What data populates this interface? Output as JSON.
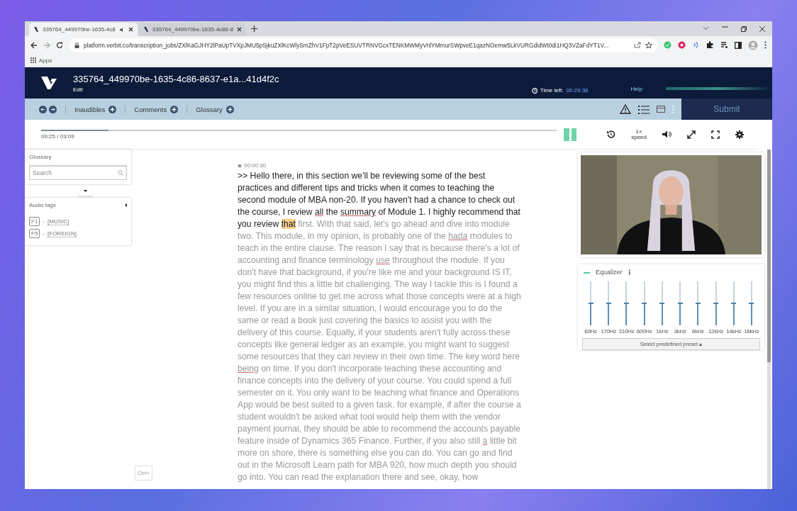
{
  "browser": {
    "tabs": [
      {
        "title": "335764_449970be-1635-4c8",
        "selected": true,
        "audio": true
      },
      {
        "title": "335764_449970be-1635-4c86-8",
        "selected": false,
        "audio": false
      }
    ],
    "url": "platform.verbit.co/transcription_jobs/ZXlKaGJHY2lPaUpTVXpJMU5pSjkuZXlKcWlySmZhV1FpT2pVeESUVTRNVGcxTENKMWMyVnlYMmurSWpveE1qazNOemw5LkVURGdidWt0di1HQ3VZaFdYT1V...",
    "bookmarks": [
      "Apps"
    ]
  },
  "app": {
    "job_title": "335764_449970be-1635-4c86-8637-e1a...41d4f2c",
    "subtitle": "Edit",
    "time_left_label": "Time left:",
    "time_left": "00:29:38",
    "help": "Help"
  },
  "toolbar": {
    "items": [
      {
        "label": "Inaudibles"
      },
      {
        "label": "Comments"
      },
      {
        "label": "Glossary"
      }
    ],
    "submit": "Submit"
  },
  "player": {
    "level": 0.13,
    "time": "00:25 / 03:09",
    "playing": true,
    "speed": "1×",
    "speed_label": "speed"
  },
  "glossary": {
    "title": "Glossary",
    "search": {
      "placeholder": "Search"
    },
    "expanded": true
  },
  "audio_tags": {
    "title": "Audio tags",
    "items": [
      {
        "key": "F1",
        "separator": "-",
        "tag": "[MUSIC]"
      },
      {
        "key": "F5",
        "separator": "-",
        "tag": "[FOREIGN]"
      }
    ]
  },
  "shortcut_button": "Ctrl+",
  "transcript": {
    "timestamp": "00:00:30",
    "played": [
      {
        "text": ">> Hello there, in this section we'll be reviewing some of the best practices and different tips and tricks when it comes to teaching the second module of MBA non-20. If you haven't had a chance to check out the course, I review ",
        "kind": "plain"
      },
      {
        "text": "all",
        "kind": "flagged"
      },
      {
        "text": " the ",
        "kind": "plain"
      },
      {
        "text": "summary",
        "kind": "flagged"
      },
      {
        "text": " of Module 1. I highly recommend that you review ",
        "kind": "plain"
      },
      {
        "text": "that",
        "kind": "current"
      }
    ],
    "upcoming": [
      {
        "text": " first. With that said, let's go ahead and dive into module two. This module, in my opinion, is probably one of the ",
        "kind": "plain"
      },
      {
        "text": "hada",
        "kind": "flagged"
      },
      {
        "text": " modules to teach in the entire clause. The reason I say that is because there's a lot of accounting and finance terminology ",
        "kind": "plain"
      },
      {
        "text": "use",
        "kind": "flagged"
      },
      {
        "text": " throughout the module. If you don't have that background, if you're like me and your background IS IT, you might find this a little bit challenging. The way I tackle this is I found a few resources online to get me across what those concepts were at a high level. If you are in a similar situation, I would encourage you to do the same or read a book just covering the basics to assist you with the delivery of this course. Equally, if your students aren't fully across these concepts like general ledger as an example, you might want to suggest some resources that they can review in their own time. The key word here ",
        "kind": "plain"
      },
      {
        "text": "being",
        "kind": "flagged"
      },
      {
        "text": " on time. If you don't incorporate teaching these accounting and finance concepts into the delivery of your course. You could spend a full semester on it. You only want to be teaching what finance and Operations App would be best suited to a given task. for example, if after the course a student wouldn't be asked what tool would help them with the vendor payment journal, they should be able to recommend the accounts payable feature inside of Dynamics 365 Finance. Further, if you also still ",
        "kind": "plain"
      },
      {
        "text": "a",
        "kind": "flagged"
      },
      {
        "text": " little bit more on shore, there is something else you can do. You can go and find out in the Microsoft Learn path for MBA 920, how much depth you should go into. You can read the explanation there and see, okay, how",
        "kind": "plain"
      }
    ]
  },
  "equalizer": {
    "title": "Equalizer",
    "expanded": true,
    "bands": [
      {
        "label": "60Hz",
        "level": 0.5
      },
      {
        "label": "170Hz",
        "level": 0.5
      },
      {
        "label": "310Hz",
        "level": 0.5
      },
      {
        "label": "600Hz",
        "level": 0.5
      },
      {
        "label": "1kHz",
        "level": 0.5
      },
      {
        "label": "3kHz",
        "level": 0.5
      },
      {
        "label": "6kHz",
        "level": 0.5
      },
      {
        "label": "12kHz",
        "level": 0.5
      },
      {
        "label": "14kHz",
        "level": 0.5
      },
      {
        "label": "16kHz",
        "level": 0.5
      }
    ],
    "preset_button": "Select predefined preset ▴"
  }
}
